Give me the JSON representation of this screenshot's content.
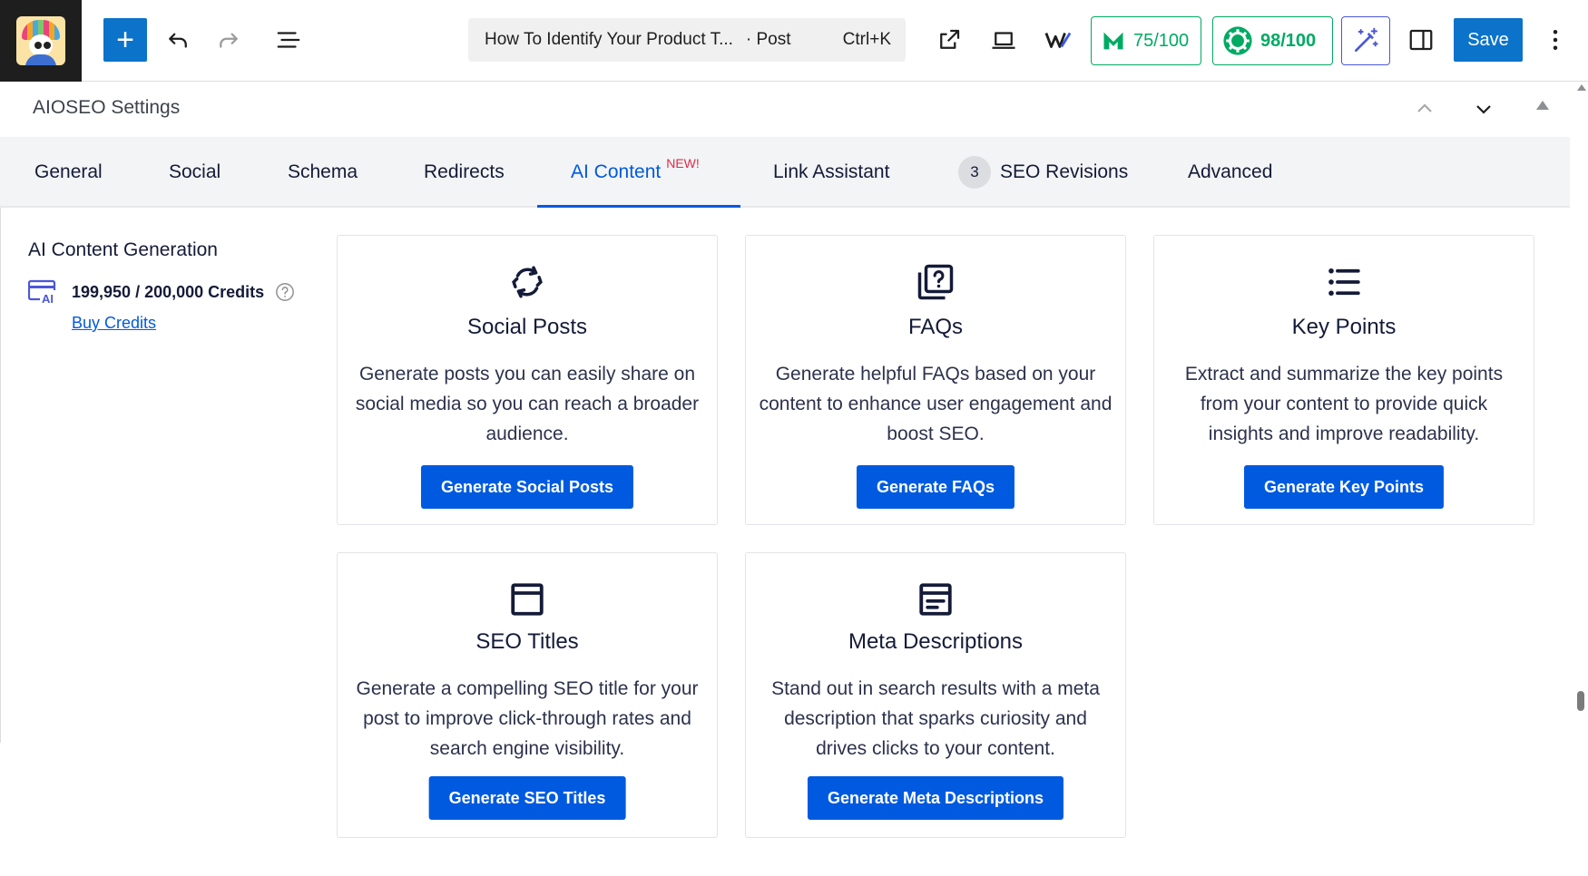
{
  "toolbar": {
    "command_title": "How To Identify Your Product T...",
    "command_type": "· Post",
    "command_shortcut": "Ctrl+K",
    "score_1": "75/100",
    "score_2": "98/100",
    "save_label": "Save"
  },
  "panel": {
    "title": "AIOSEO Settings"
  },
  "tabs": [
    {
      "label": "General"
    },
    {
      "label": "Social"
    },
    {
      "label": "Schema"
    },
    {
      "label": "Redirects"
    },
    {
      "label": "AI Content",
      "badge": "NEW!",
      "active": true
    },
    {
      "label": "Link Assistant"
    },
    {
      "label": "SEO Revisions",
      "count": "3"
    },
    {
      "label": "Advanced"
    }
  ],
  "sidebar": {
    "title": "AI Content Generation",
    "credits": "199,950 / 200,000 Credits",
    "buy_link": "Buy Credits"
  },
  "cards": [
    {
      "icon": "refresh-arrows-icon",
      "title": "Social Posts",
      "description": "Generate posts you can easily share on social media so you can reach a broader audience.",
      "button": "Generate Social Posts"
    },
    {
      "icon": "faq-question-icon",
      "title": "FAQs",
      "description": "Generate helpful FAQs based on your content to enhance user engagement and boost SEO.",
      "button": "Generate FAQs"
    },
    {
      "icon": "list-icon",
      "title": "Key Points",
      "description": "Extract and summarize the key points from your content to provide quick insights and improve readability.",
      "button": "Generate Key Points"
    },
    {
      "icon": "title-window-icon",
      "title": "SEO Titles",
      "description": "Generate a compelling SEO title for your post to improve click-through rates and search engine visibility.",
      "button": "Generate SEO Titles"
    },
    {
      "icon": "meta-description-icon",
      "title": "Meta Descriptions",
      "description": "Stand out in search results with a meta description that sparks curiosity and drives clicks to your content.",
      "button": "Generate Meta Descriptions"
    }
  ],
  "colors": {
    "primary": "#005ae0",
    "wp_blue": "#0b73c9",
    "score_green": "#00aa63",
    "new_badge": "#df2a4a"
  }
}
